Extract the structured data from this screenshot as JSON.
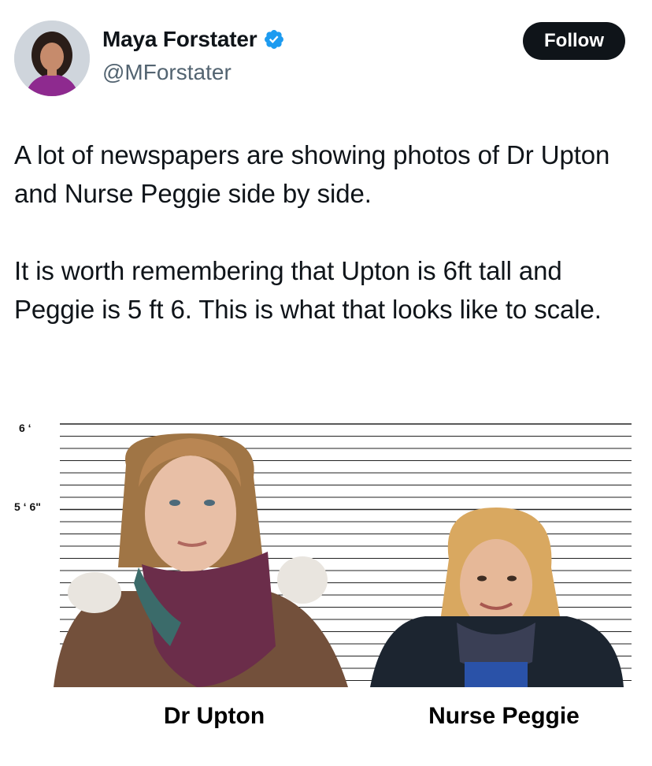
{
  "author": {
    "display_name": "Maya Forstater",
    "handle": "@MForstater",
    "avatar_icon": "profile-photo",
    "verified_icon": "verified-badge-icon",
    "verified_color": "#1d9bf0"
  },
  "follow_button": {
    "label": "Follow"
  },
  "tweet": {
    "paragraphs": [
      "A lot of newspapers are showing photos of Dr Upton and Nurse Peggie side by side.",
      "It is worth remembering that Upton is 6ft tall and Peggie is 5 ft 6.  This is what that looks like to scale."
    ]
  },
  "media": {
    "height_marks": [
      "6 ‘",
      "5 ‘ 6\""
    ],
    "captions": [
      "Dr Upton",
      "Nurse Peggie"
    ]
  }
}
